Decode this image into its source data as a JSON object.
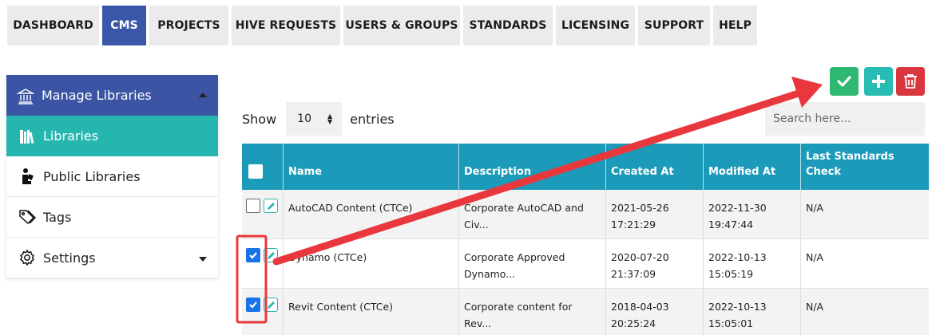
{
  "nav": {
    "tabs": [
      {
        "label": "DASHBOARD",
        "active": false
      },
      {
        "label": "CMS",
        "active": true
      },
      {
        "label": "PROJECTS",
        "active": false
      },
      {
        "label": "HIVE REQUESTS",
        "active": false
      },
      {
        "label": "USERS & GROUPS",
        "active": false
      },
      {
        "label": "STANDARDS",
        "active": false
      },
      {
        "label": "LICENSING",
        "active": false
      },
      {
        "label": "SUPPORT",
        "active": false
      },
      {
        "label": "HELP",
        "active": false
      }
    ]
  },
  "sidebar": {
    "header": "Manage Libraries",
    "items": [
      {
        "label": "Libraries",
        "icon": "books-icon",
        "active": true
      },
      {
        "label": "Public Libraries",
        "icon": "reader-icon",
        "active": false
      },
      {
        "label": "Tags",
        "icon": "tags-icon",
        "active": false
      },
      {
        "label": "Settings",
        "icon": "gear-icon",
        "active": false
      }
    ]
  },
  "toolbar": {
    "show_label": "Show",
    "entries_value": "10",
    "entries_label": "entries",
    "search_placeholder": "Search here..."
  },
  "table": {
    "columns": [
      "Name",
      "Description",
      "Created At",
      "Modified At",
      "Last Standards Check"
    ],
    "header_lines": {
      "last_check_1": "Last Standards",
      "last_check_2": "Check"
    },
    "rows": [
      {
        "checked": false,
        "name": "AutoCAD Content (CTCe)",
        "desc1": "Corporate AutoCAD and",
        "desc2": "Civ...",
        "created1": "2021-05-26",
        "created2": "17:21:29",
        "modified1": "2022-11-30",
        "modified2": "19:47:44",
        "last_check": "N/A"
      },
      {
        "checked": true,
        "name": "Dynamo (CTCe)",
        "desc1": "Corporate Approved",
        "desc2": "Dynamo...",
        "created1": "2020-07-20",
        "created2": "21:37:09",
        "modified1": "2022-10-13 15:05:19",
        "modified2": "",
        "last_check": "N/A"
      },
      {
        "checked": true,
        "name": "Revit Content (CTCe)",
        "desc1": "Corporate content for Rev...",
        "desc2": "",
        "created1": "2018-04-03",
        "created2": "20:25:24",
        "modified1": "2022-10-13 15:05:01",
        "modified2": "",
        "last_check": "N/A"
      }
    ]
  },
  "colors": {
    "nav_active": "#3a56a8",
    "sidebar_active": "#26b6b0",
    "table_header": "#1b9ab9",
    "approve": "#2eb872",
    "add": "#27bcb4",
    "delete": "#d9363e",
    "annotation": "#e8383d"
  }
}
